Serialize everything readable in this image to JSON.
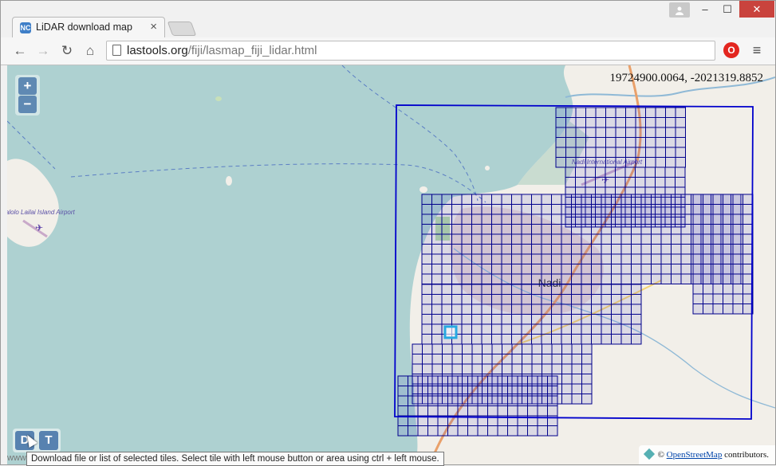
{
  "browser": {
    "tab_title": "LiDAR download map",
    "tab_close": "×",
    "favicon": "NC",
    "url_host": "lastools.org",
    "url_path": "/fiji/lasmap_fiji_lidar.html",
    "window_controls": {
      "minimize": "–",
      "maximize": "☐",
      "close": "✕"
    },
    "nav": {
      "back": "←",
      "forward": "→",
      "reload": "↻",
      "home": "⌂",
      "menu": "≡"
    }
  },
  "map": {
    "coordinates": "19724900.0064, -2021319.8852",
    "zoom_in": "+",
    "zoom_out": "−",
    "tools": {
      "download": "D",
      "tile": "T"
    },
    "labels": {
      "town": "Nadi",
      "airport_nadi": "Nadi International Airport",
      "airport_malolo": "Malolo Lailai Island Airport"
    },
    "attribution": {
      "prefix": "©",
      "link": "OpenStreetMap",
      "suffix": "contributors."
    },
    "tooltip": "Download file or list of selected tiles. Select tile with left mouse button or area using ctrl + left mouse.",
    "status_hint": "www",
    "colors": {
      "water": "#aed1d1",
      "land": "#f2efe9",
      "tile_stroke": "#00008b",
      "selected_tile": "#27a9e1",
      "road": "#e9a06a"
    }
  }
}
